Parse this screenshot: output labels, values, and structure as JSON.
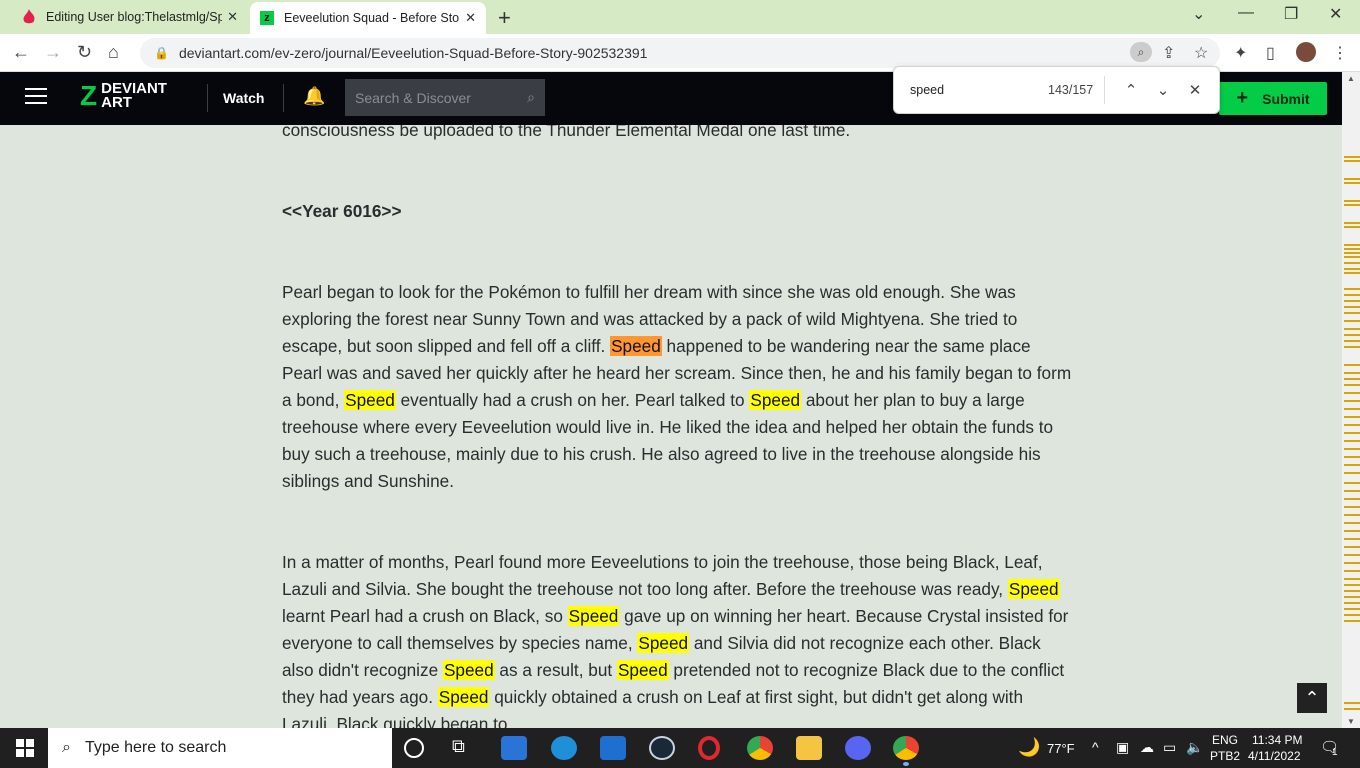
{
  "browser": {
    "tabs": [
      {
        "title": "Editing User blog:Thelastmlg/Spe",
        "close": "✕"
      },
      {
        "title": "Eeveelution Squad - Before Story",
        "close": "✕"
      }
    ],
    "new_tab": "+",
    "url": "deviantart.com/ev-zero/journal/Eeveelution-Squad-Before-Story-902532391"
  },
  "find_bar": {
    "query": "speed",
    "count": "143/157"
  },
  "deviantart": {
    "logo_line1": "DEVIANT",
    "logo_line2": "ART",
    "watch": "Watch",
    "search_placeholder": "Search & Discover",
    "submit": "Submit"
  },
  "article": {
    "line_top": "consciousness be uploaded to the Thunder Elemental Medal one last time.",
    "heading": "<<Year 6016>>",
    "p1": [
      {
        "t": "Pearl began to look for the Pokémon to fulfill her dream with since she was old enough. She was exploring the forest near Sunny Town and was attacked by a pack of wild Mightyena. She tried to escape, but soon slipped and fell off a cliff. "
      },
      {
        "m": "Speed",
        "cur": true
      },
      {
        "t": " happened to be wandering near the same place Pearl was and saved her quickly after he heard her scream. Since then, he and his family began to form a bond, "
      },
      {
        "m": "Speed"
      },
      {
        "t": " eventually had a crush on her. Pearl talked to "
      },
      {
        "m": "Speed"
      },
      {
        "t": " about her plan to buy a large treehouse where every Eeveelution would live in. He liked the idea and helped her obtain the funds to buy such a treehouse, mainly due to his crush. He also agreed to live in the treehouse alongside his siblings and Sunshine."
      }
    ],
    "p2": [
      {
        "t": "In a matter of months, Pearl found more Eeveelutions to join the treehouse, those being Black, Leaf, Lazuli and Silvia. She bought the treehouse not too long after. Before the treehouse was ready, "
      },
      {
        "m": "Speed"
      },
      {
        "t": " learnt Pearl had a crush on Black, so "
      },
      {
        "m": "Speed"
      },
      {
        "t": " gave up on winning her heart. Because Crystal insisted for everyone to call themselves by species name, "
      },
      {
        "m": "Speed"
      },
      {
        "t": " and Silvia did not recognize each other. Black also didn't recognize "
      },
      {
        "m": "Speed"
      },
      {
        "t": " as a result, but "
      },
      {
        "m": "Speed"
      },
      {
        "t": " pretended not to recognize Black due to the conflict they had years ago. "
      },
      {
        "m": "Speed"
      },
      {
        "t": " quickly obtained a crush on Leaf at first sight, but didn't get along with Lazuli. Black quickly began to"
      }
    ]
  },
  "taskbar": {
    "search_placeholder": "Type here to search",
    "weather": "77°F",
    "lang1": "ENG",
    "lang2": "PTB2",
    "time": "11:34 PM",
    "date": "4/11/2022",
    "notif": "1"
  },
  "colors": {
    "highlight": "#ffff00",
    "current_highlight": "#ff9632",
    "da_green": "#05cc47"
  }
}
